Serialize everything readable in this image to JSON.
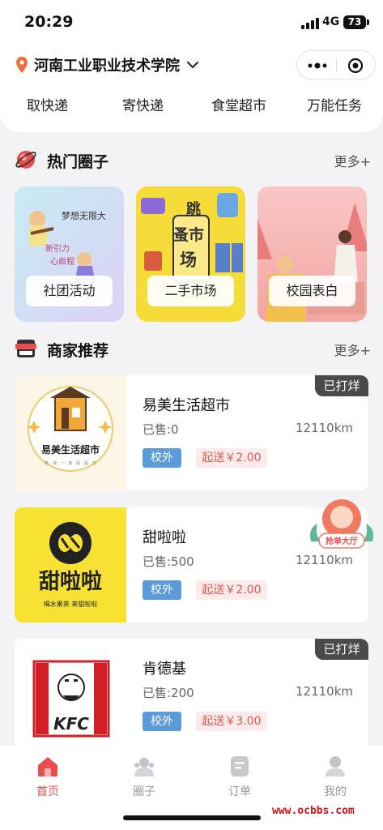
{
  "status": {
    "time": "20:29",
    "network": "4G",
    "battery": "73"
  },
  "header": {
    "location": "河南工业职业技术学院",
    "quick_nav": [
      "取快递",
      "寄快递",
      "食堂超市",
      "万能任务"
    ]
  },
  "circles": {
    "title": "热门圈子",
    "more": "更多+",
    "cards": [
      {
        "label": "社团活动",
        "art_text_1": "梦想无限大",
        "art_text_2": "新引力",
        "art_text_3": "心启程"
      },
      {
        "label": "二手市场",
        "art_text_1": "跳",
        "art_text_2": "蚤市",
        "art_text_3": "场"
      },
      {
        "label": "校园表白"
      }
    ]
  },
  "merchants": {
    "title": "商家推荐",
    "more": "更多+",
    "items": [
      {
        "name": "易美生活超市",
        "sold": "已售:0",
        "distance": "12110km",
        "tag": "校外",
        "min": "起送￥2.00",
        "closed": "已打烊",
        "logo_text": "易美生活超市",
        "logo_sub": "真 · 诚 · 一 · 家 · 经 · 超 · 市"
      },
      {
        "name": "甜啦啦",
        "sold": "已售:500",
        "distance": "12110km",
        "tag": "校外",
        "min": "起送￥2.00",
        "logo_text": "甜啦啦",
        "logo_sub": "喝水果茶  来甜啦啦"
      },
      {
        "name": "肯德基",
        "sold": "已售:200",
        "distance": "12110km",
        "tag": "校外",
        "min": "起送￥3.00",
        "closed": "已打烊",
        "logo_text": "KFC"
      }
    ]
  },
  "float_badge": {
    "label": "抢单大厅"
  },
  "tabbar": [
    {
      "label": "首页",
      "icon": "home-icon"
    },
    {
      "label": "圈子",
      "icon": "circle-icon"
    },
    {
      "label": "订单",
      "icon": "order-icon"
    },
    {
      "label": "我的",
      "icon": "profile-icon"
    }
  ],
  "watermark": "www.ocbbs.com",
  "colors": {
    "accent": "#e94e4e",
    "tag_blue": "#5b9bd8",
    "tag_red": "#e2584f"
  }
}
